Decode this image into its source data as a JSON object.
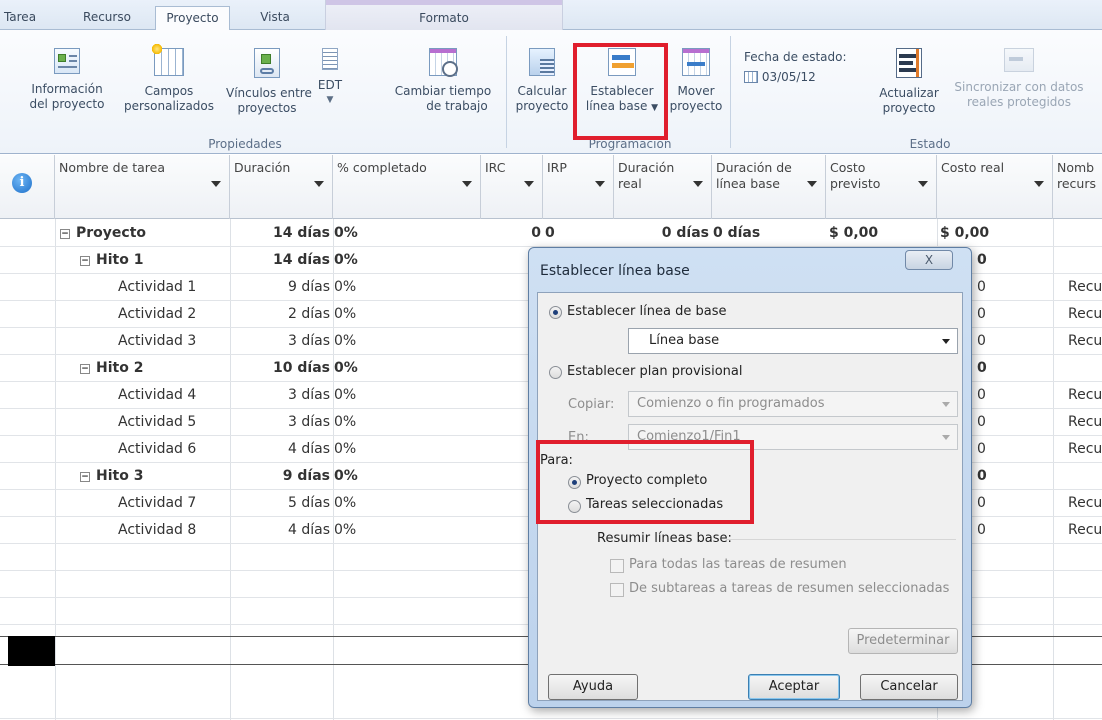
{
  "tabs": [
    "Tarea",
    "Recurso",
    "Proyecto",
    "Vista",
    "Formato"
  ],
  "ribbon": {
    "project_info": [
      "Información",
      "del proyecto"
    ],
    "custom_fields": [
      "Campos",
      "personalizados"
    ],
    "links": [
      "Vínculos entre",
      "proyectos"
    ],
    "wbs": "EDT",
    "change_worktime": [
      "Cambiar tiempo",
      "de trabajo"
    ],
    "properties_group": "Propiedades",
    "calculate": [
      "Calcular",
      "proyecto"
    ],
    "set_baseline": [
      "Establecer",
      "línea base"
    ],
    "move_project": [
      "Mover",
      "proyecto"
    ],
    "schedule_group": "Programación",
    "status_date_label": "Fecha de estado:",
    "status_date_value": "03/05/12",
    "update_project": [
      "Actualizar",
      "proyecto"
    ],
    "sync_protected": [
      "Sincronizar con datos",
      "reales protegidos"
    ],
    "status_group": "Estado"
  },
  "columns": {
    "task_name": "Nombre de tarea",
    "duration": "Duración",
    "pct_complete": "% completado",
    "irc": "IRC",
    "irp": "IRP",
    "actual_duration": [
      "Duración",
      "real"
    ],
    "baseline_duration": [
      "Duración de",
      "línea base"
    ],
    "cost": [
      "Costo",
      "previsto"
    ],
    "actual_cost": "Costo real",
    "resource_names": [
      "Nomb",
      "recurs"
    ]
  },
  "rows": [
    {
      "name": "Proyecto",
      "duration": "14 días",
      "pct": "0%",
      "irc": "0",
      "irp": "0",
      "actual_duration": "0 días",
      "baseline_duration": "0 días",
      "cost": "$ 0,00",
      "actual_cost": "$ 0,00",
      "resource": ""
    },
    {
      "name": "Hito 1",
      "duration": "14 días",
      "pct": "0%",
      "actual_cost_tail": "0",
      "resource": ""
    },
    {
      "name": "Actividad 1",
      "duration": "9 días",
      "pct": "0%",
      "actual_cost_tail": "0",
      "resource": "Recur"
    },
    {
      "name": "Actividad 2",
      "duration": "2 días",
      "pct": "0%",
      "actual_cost_tail": "0",
      "resource": "Recur"
    },
    {
      "name": "Actividad 3",
      "duration": "3 días",
      "pct": "0%",
      "actual_cost_tail": "0",
      "resource": "Recur"
    },
    {
      "name": "Hito 2",
      "duration": "10 días",
      "pct": "0%",
      "actual_cost_tail": "0",
      "resource": ""
    },
    {
      "name": "Actividad 4",
      "duration": "3 días",
      "pct": "0%",
      "actual_cost_tail": "0",
      "resource": "Recur"
    },
    {
      "name": "Actividad 5",
      "duration": "3 días",
      "pct": "0%",
      "actual_cost_tail": "0",
      "resource": "Recur"
    },
    {
      "name": "Actividad 6",
      "duration": "4 días",
      "pct": "0%",
      "actual_cost_tail": "0",
      "resource": "Recur"
    },
    {
      "name": "Hito 3",
      "duration": "9 días",
      "pct": "0%",
      "actual_cost_tail": "0",
      "resource": ""
    },
    {
      "name": "Actividad 7",
      "duration": "5 días",
      "pct": "0%",
      "actual_cost_tail": "0",
      "resource": "Recur"
    },
    {
      "name": "Actividad 8",
      "duration": "4 días",
      "pct": "0%",
      "actual_cost_tail": "0",
      "resource": "Recur"
    }
  ],
  "dialog": {
    "title": "Establecer línea base",
    "close": "X",
    "set_baseline": "Establecer línea de base",
    "baseline_value": "Línea base",
    "set_interim": "Establecer plan provisional",
    "copy_label": "Copiar:",
    "copy_value": "Comienzo o fin programados",
    "into_label": "En:",
    "into_value": "Comienzo1/Fin1",
    "for_label": "Para:",
    "entire_project": "Proyecto completo",
    "selected_tasks": "Tareas seleccionadas",
    "rollup_label": "Resumir líneas base:",
    "rollup_all": "Para todas las tareas de resumen",
    "rollup_selected": "De subtareas a tareas de resumen seleccionadas",
    "set_default": "Predeterminar",
    "help": "Ayuda",
    "ok": "Aceptar",
    "cancel": "Cancelar"
  }
}
